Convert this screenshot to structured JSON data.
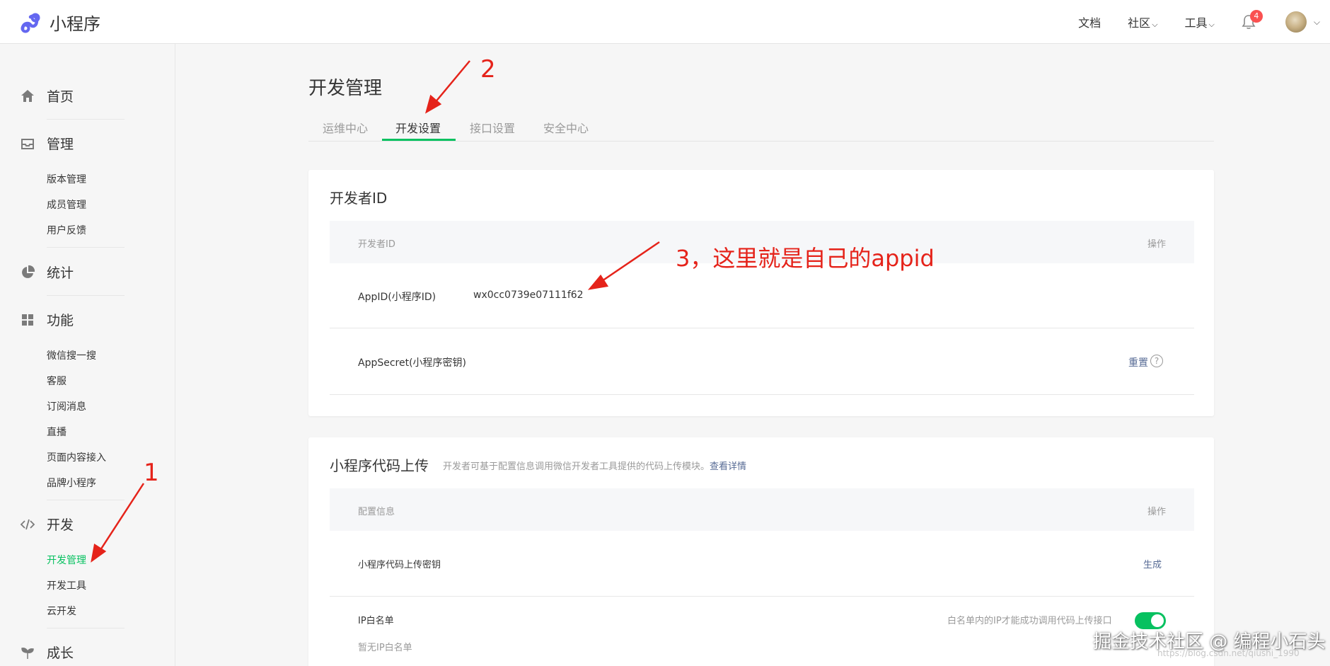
{
  "app": {
    "title": "小程序"
  },
  "topnav": {
    "docs": "文档",
    "community": "社区",
    "tools": "工具",
    "notification_count": "4"
  },
  "sidebar": {
    "home": "首页",
    "manage": "管理",
    "manage_items": [
      "版本管理",
      "成员管理",
      "用户反馈"
    ],
    "stats": "统计",
    "features": "功能",
    "feature_items": [
      "微信搜一搜",
      "客服",
      "订阅消息",
      "直播",
      "页面内容接入",
      "品牌小程序"
    ],
    "develop": "开发",
    "develop_items": [
      "开发管理",
      "开发工具",
      "云开发"
    ],
    "growth": "成长"
  },
  "page": {
    "title": "开发管理",
    "tabs": [
      "运维中心",
      "开发设置",
      "接口设置",
      "安全中心"
    ],
    "active_tab": "开发设置"
  },
  "dev_id_card": {
    "title": "开发者ID",
    "col_name": "开发者ID",
    "col_action": "操作",
    "appid_label": "AppID(小程序ID)",
    "appid_value": "wx0cc0739e07111f62",
    "secret_label": "AppSecret(小程序密钥)",
    "secret_action": "重置",
    "help": "?"
  },
  "upload_card": {
    "title": "小程序代码上传",
    "subtitle": "开发者可基于配置信息调用微信开发者工具提供的代码上传模块。",
    "subtitle_link": "查看详情",
    "col_config": "配置信息",
    "col_action": "操作",
    "key_label": "小程序代码上传密钥",
    "key_action": "生成",
    "ip_label": "IP白名单",
    "ip_empty": "暂无IP白名单",
    "ip_note": "白名单内的IP才能成功调用代码上传接口",
    "toggle_on": true
  },
  "annotations": {
    "one": "1",
    "two": "2",
    "three": "3，这里就是自己的appid"
  },
  "watermark": {
    "main": "掘金技术社区 @ 编程小石头",
    "sub": "https://blog.csdn.net/qiushi_1990"
  },
  "colors": {
    "accent": "#07c160",
    "link": "#576b95",
    "annotation": "#e5231a"
  }
}
